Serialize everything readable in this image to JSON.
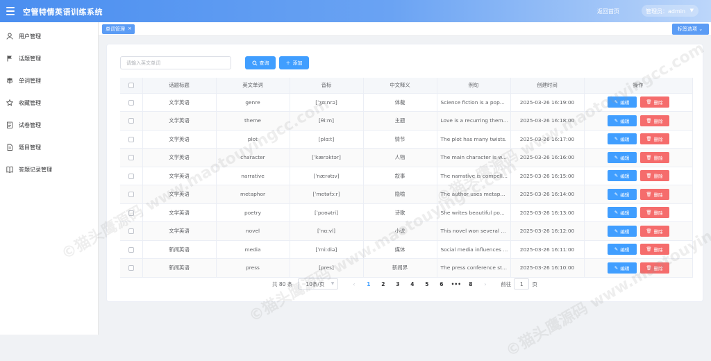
{
  "header": {
    "title": "空管特情英语训练系统",
    "back_home": "返回首页",
    "admin_label": "管理员：admin"
  },
  "sidebar": {
    "items": [
      {
        "label": "用户管理",
        "icon": "user-icon"
      },
      {
        "label": "话题管理",
        "icon": "flag-icon"
      },
      {
        "label": "单词管理",
        "icon": "signpost-icon"
      },
      {
        "label": "收藏管理",
        "icon": "star-icon"
      },
      {
        "label": "试卷管理",
        "icon": "paper-icon"
      },
      {
        "label": "题目管理",
        "icon": "document-icon"
      },
      {
        "label": "答题记录管理",
        "icon": "book-icon"
      }
    ]
  },
  "tagbar": {
    "active_tag": "单词管理",
    "close_glyph": "×",
    "options_label": "标签选项"
  },
  "toolbar": {
    "search_placeholder": "请输入英文单词",
    "search_value": "",
    "search_label": "查询",
    "add_label": "添加"
  },
  "table": {
    "columns": [
      "话题标题",
      "英文单词",
      "音标",
      "中文释义",
      "例句",
      "创建时间",
      "操作"
    ],
    "edit_label": "编辑",
    "delete_label": "删除",
    "rows": [
      {
        "topic": "文学英语",
        "word": "genre",
        "phonetic": "[ˈʒɑːnrə]",
        "meaning": "体裁",
        "example": "Science fiction is a pop...",
        "created": "2025-03-26 16:19:00"
      },
      {
        "topic": "文学英语",
        "word": "theme",
        "phonetic": "[θiːm]",
        "meaning": "主题",
        "example": "Love is a recurring theme...",
        "created": "2025-03-26 16:18:00"
      },
      {
        "topic": "文学英语",
        "word": "plot",
        "phonetic": "[plɑːt]",
        "meaning": "情节",
        "example": "The plot has many twists.",
        "created": "2025-03-26 16:17:00"
      },
      {
        "topic": "文学英语",
        "word": "character",
        "phonetic": "[ˈkærəktər]",
        "meaning": "人物",
        "example": "The main character is w...",
        "created": "2025-03-26 16:16:00"
      },
      {
        "topic": "文学英语",
        "word": "narrative",
        "phonetic": "[ˈnærətɪv]",
        "meaning": "叙事",
        "example": "The narrative is compell...",
        "created": "2025-03-26 16:15:00"
      },
      {
        "topic": "文学英语",
        "word": "metaphor",
        "phonetic": "[ˈmetəfɔːr]",
        "meaning": "隐喻",
        "example": "The author uses metap...",
        "created": "2025-03-26 16:14:00"
      },
      {
        "topic": "文学英语",
        "word": "poetry",
        "phonetic": "[ˈpoʊətri]",
        "meaning": "诗歌",
        "example": "She writes beautiful po...",
        "created": "2025-03-26 16:13:00"
      },
      {
        "topic": "文学英语",
        "word": "novel",
        "phonetic": "[ˈnɑːvl]",
        "meaning": "小说",
        "example": "This novel won several ...",
        "created": "2025-03-26 16:12:00"
      },
      {
        "topic": "新闻英语",
        "word": "media",
        "phonetic": "[ˈmiːdiə]",
        "meaning": "媒体",
        "example": "Social media influences ...",
        "created": "2025-03-26 16:11:00"
      },
      {
        "topic": "新闻英语",
        "word": "press",
        "phonetic": "[pres]",
        "meaning": "新闻界",
        "example": "The press conference st...",
        "created": "2025-03-26 16:10:00"
      }
    ]
  },
  "pagination": {
    "total_text": "共 80 条",
    "page_size": "10条/页",
    "prev_glyph": "‹",
    "next_glyph": "›",
    "pages": [
      "1",
      "2",
      "3",
      "4",
      "5",
      "6",
      "•••",
      "8"
    ],
    "current_page": "1",
    "goto_label": "前往",
    "goto_value": "1",
    "page_suffix": "页"
  },
  "watermark": "©猫头鹰源码  www.maotouyingcc.com",
  "colors": {
    "primary": "#409eff",
    "danger": "#f56c6c",
    "header_start": "#4a8ef0",
    "header_end": "#bcd6fa"
  }
}
